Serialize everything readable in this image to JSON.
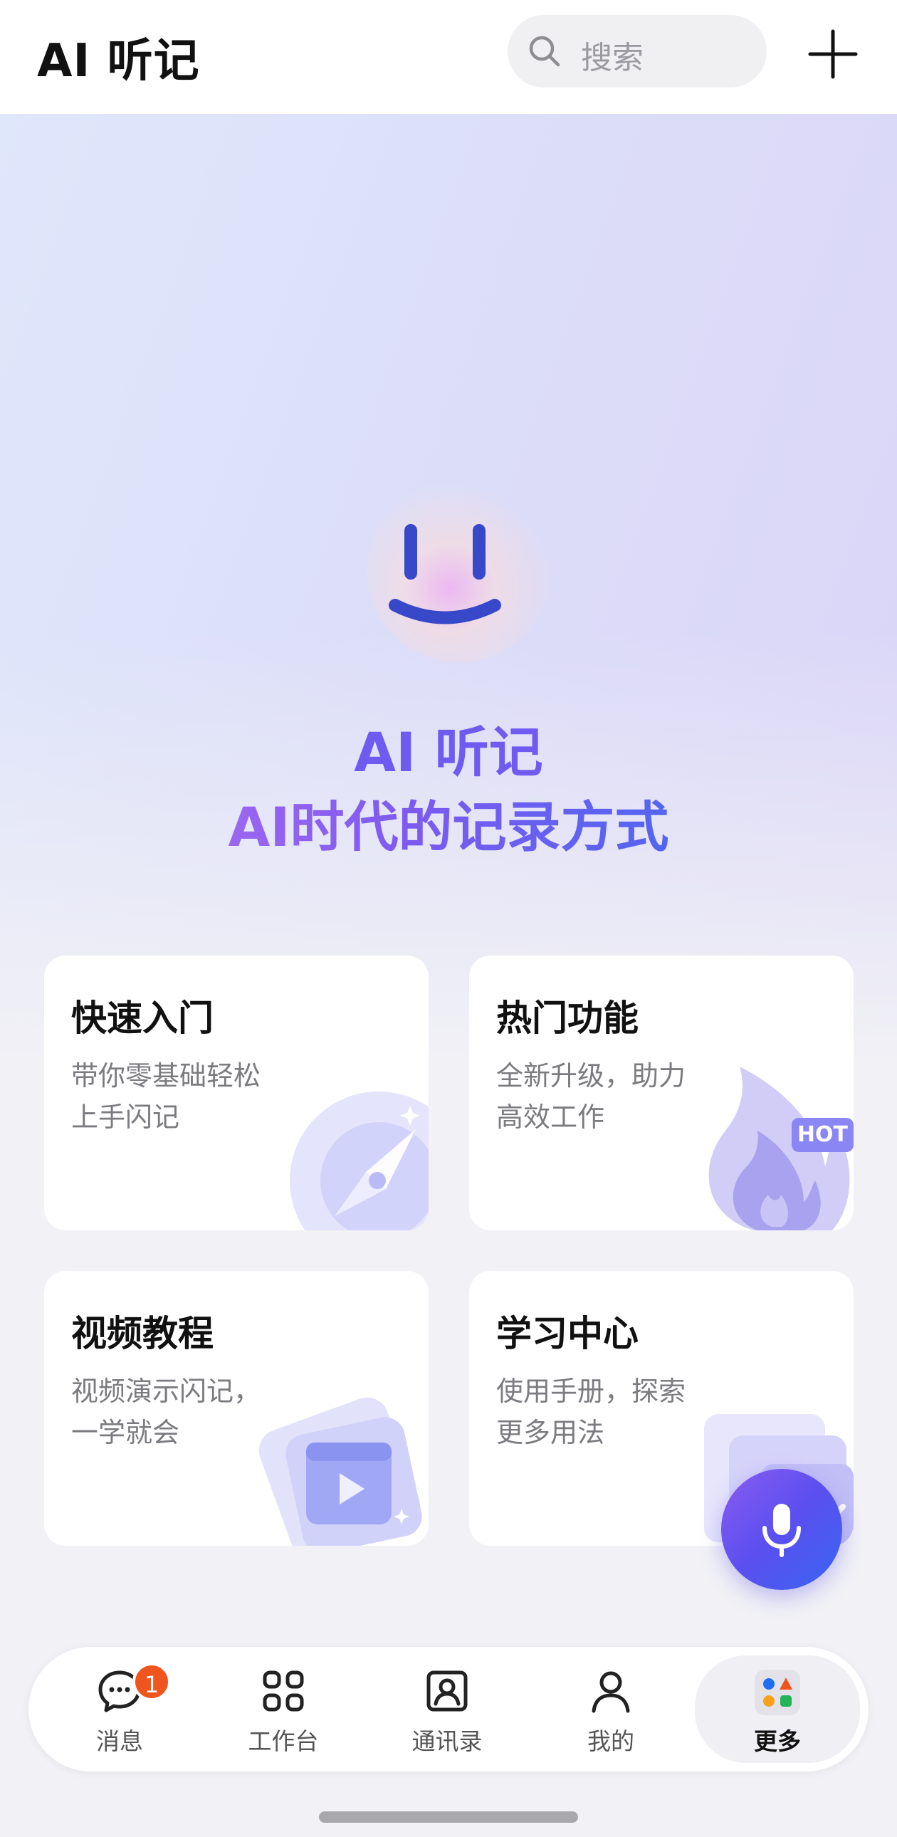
{
  "header": {
    "title": "AI 听记",
    "search_placeholder": "搜索",
    "search_icon": "search-icon",
    "add_icon": "plus-icon"
  },
  "hero": {
    "mascot_icon": "smiley-face-icon",
    "title": "AI 听记",
    "subtitle": "AI时代的记录方式"
  },
  "cards": [
    {
      "title": "快速入门",
      "description": "带你零基础轻松上手闪记",
      "icon": "compass-icon"
    },
    {
      "title": "热门功能",
      "description": "全新升级，助力高效工作",
      "icon": "flame-icon",
      "badge": "HOT"
    },
    {
      "title": "视频教程",
      "description": "视频演示闪记，一学就会",
      "icon": "play-video-icon"
    },
    {
      "title": "学习中心",
      "description": "使用手册，探索更多用法",
      "icon": "book-stack-icon"
    }
  ],
  "fab": {
    "icon": "microphone-icon"
  },
  "bottom_nav": {
    "items": [
      {
        "label": "消息",
        "icon": "chat-bubble-icon",
        "badge": "1"
      },
      {
        "label": "工作台",
        "icon": "grid-icon"
      },
      {
        "label": "通讯录",
        "icon": "contacts-icon"
      },
      {
        "label": "我的",
        "icon": "person-icon"
      },
      {
        "label": "更多",
        "icon": "apps-more-icon",
        "active": true
      }
    ]
  },
  "colors": {
    "accent": "#6f5bf0",
    "gradient_start": "#c277f0",
    "gradient_end": "#2f6ff0",
    "badge": "#f0541f"
  }
}
